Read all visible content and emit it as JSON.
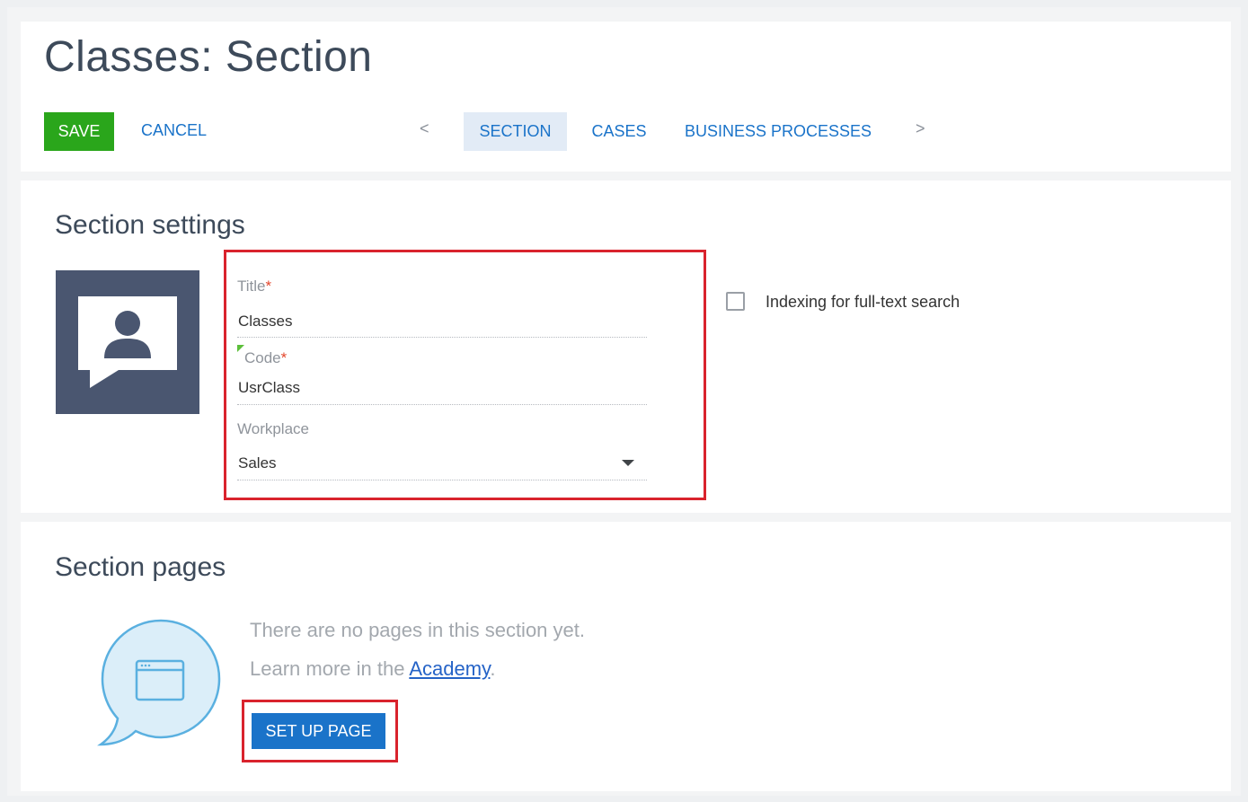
{
  "header": {
    "title": "Classes: Section",
    "save_label": "SAVE",
    "cancel_label": "CANCEL"
  },
  "tabs": {
    "prev_arrow": "<",
    "next_arrow": ">",
    "items": [
      {
        "label": "SECTION",
        "active": true
      },
      {
        "label": "CASES",
        "active": false
      },
      {
        "label": "BUSINESS PROCESSES",
        "active": false
      }
    ]
  },
  "settings": {
    "heading": "Section settings",
    "icon": "user-chat-icon",
    "title_field": {
      "label": "Title",
      "required_mark": "*",
      "value": "Classes"
    },
    "code_field": {
      "label": "Code",
      "required_mark": "*",
      "value": "UsrClass"
    },
    "workplace_field": {
      "label": "Workplace",
      "value": "Sales"
    },
    "indexing": {
      "label": "Indexing for full-text search",
      "checked": false
    }
  },
  "pages": {
    "heading": "Section pages",
    "empty_message": "There are no pages in this section yet.",
    "learn_prefix": "Learn more in the ",
    "learn_link": "Academy",
    "learn_suffix": ".",
    "setup_label": "SET UP PAGE",
    "icon": "browser-window-bubble-icon"
  },
  "colors": {
    "save_green": "#2aa61b",
    "accent_blue": "#1a73c9",
    "highlight_red": "#d9232d",
    "icon_tile": "#4a5670",
    "bubble_fill": "#dbeef9",
    "bubble_stroke": "#5ab0e0"
  }
}
